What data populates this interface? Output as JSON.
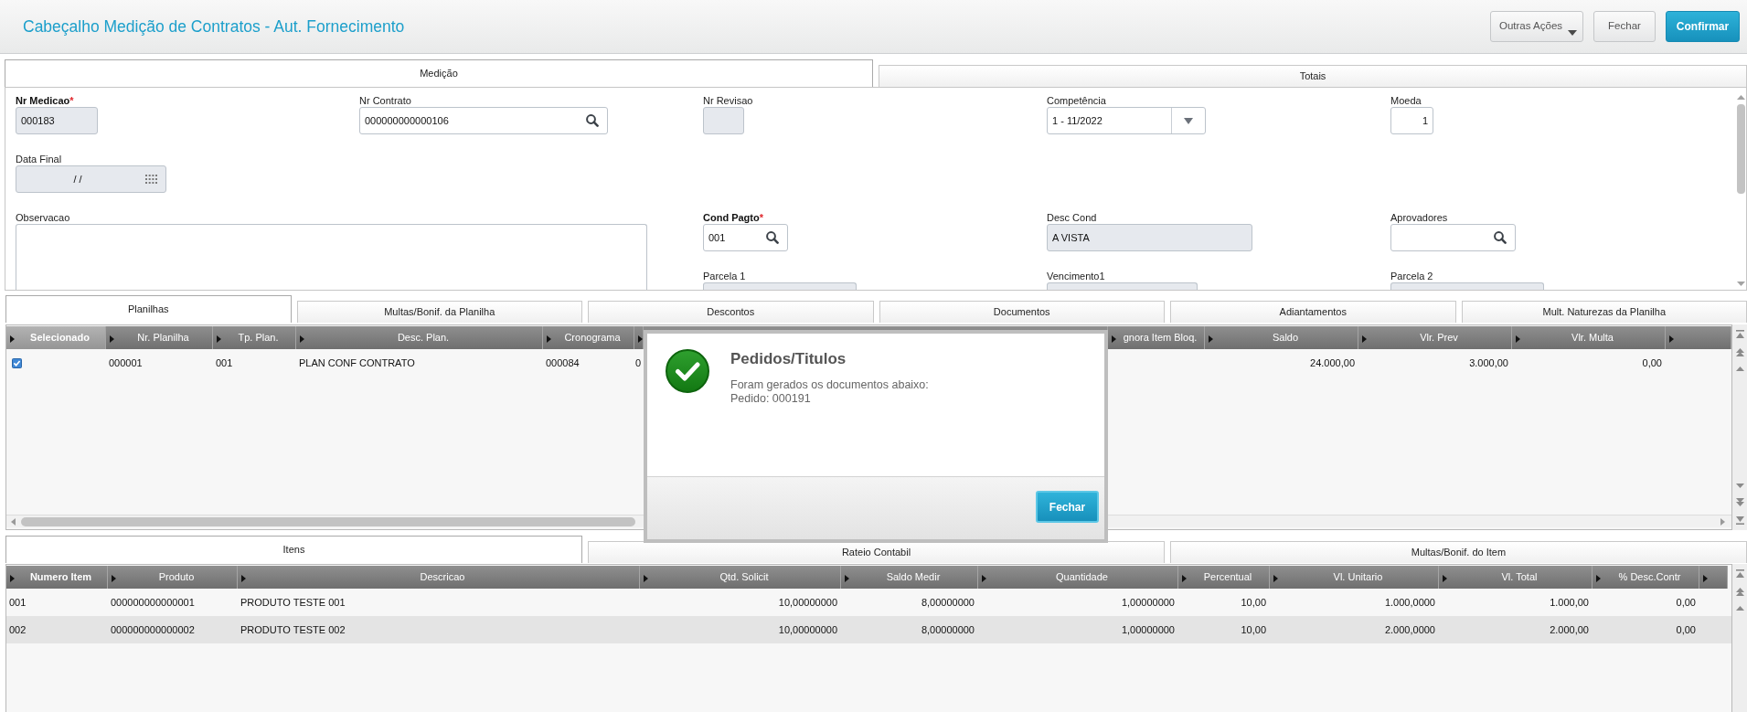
{
  "header": {
    "title": "Cabeçalho Medição de Contratos - Aut. Fornecimento",
    "buttons": [
      {
        "label": "Outras Ações",
        "kind": "menu"
      },
      {
        "label": "Fechar",
        "kind": "close"
      },
      {
        "label": "Confirmar",
        "kind": "confirm"
      }
    ]
  },
  "form_tabs": [
    {
      "label": "Medição",
      "selected": true
    },
    {
      "label": "Totais",
      "selected": false
    }
  ],
  "form": {
    "fields": [
      {
        "label": "Nr Medicao",
        "required": true,
        "required_mark": "*",
        "kind": "text",
        "readonly": true,
        "value": "000183"
      },
      {
        "label": "Nr Contrato",
        "required": false,
        "kind": "lookup",
        "readonly": false,
        "value": "000000000000106"
      },
      {
        "label": "Nr Revisao",
        "required": false,
        "kind": "text",
        "readonly": true
      },
      {
        "label": "Competência",
        "required": false,
        "kind": "select",
        "readonly": false,
        "value": "1 - 11/2022"
      },
      {
        "label": "Moeda",
        "required": false,
        "kind": "number",
        "readonly": false,
        "value": "1"
      },
      {
        "label": "Data Final",
        "required": false,
        "kind": "date",
        "readonly": true,
        "value": "/ /"
      },
      {
        "label": "Observacao",
        "required": false,
        "kind": "textarea",
        "readonly": false
      },
      {
        "label": "Cond Pagto",
        "required": true,
        "required_mark": "*",
        "kind": "lookup",
        "readonly": false,
        "value": "001"
      },
      {
        "label": "Desc Cond",
        "required": false,
        "kind": "text",
        "readonly": true,
        "value": "A VISTA"
      },
      {
        "label": "Aprovadores",
        "required": false,
        "kind": "lookup",
        "readonly": false
      },
      {
        "label": "Parcela 1",
        "required": false,
        "kind": "text",
        "readonly": true
      },
      {
        "label": "Vencimento1",
        "required": false,
        "kind": "text",
        "readonly": true
      },
      {
        "label": "Parcela 2",
        "required": false,
        "kind": "text",
        "readonly": true
      }
    ]
  },
  "planilha_tabs": [
    {
      "label": "Planilhas",
      "selected": true
    },
    {
      "label": "Multas/Bonif. da Planilha",
      "selected": false
    },
    {
      "label": "Descontos",
      "selected": false
    },
    {
      "label": "Documentos",
      "selected": false
    },
    {
      "label": "Adiantamentos",
      "selected": false
    },
    {
      "label": "Mult. Naturezas da Planilha",
      "selected": false
    }
  ],
  "planilhas_table": {
    "columns": [
      {
        "label": "Selecionado",
        "selected": true,
        "sorted": true
      },
      {
        "label": "Nr. Planilha",
        "selected": false,
        "sorted": false
      },
      {
        "label": "Tp. Plan.",
        "selected": false,
        "sorted": false
      },
      {
        "label": "Desc. Plan.",
        "selected": false,
        "sorted": false
      },
      {
        "label": "Cronograma",
        "selected": false,
        "sorted": false
      },
      {
        "selected": false
      },
      {
        "label": "gnora Item Bloq.",
        "selected": false,
        "sorted": false
      },
      {
        "label": "Saldo",
        "selected": false,
        "sorted": false
      },
      {
        "label": "Vlr. Prev",
        "selected": false,
        "sorted": false
      },
      {
        "label": "Vlr. Multa",
        "selected": false,
        "sorted": false
      },
      {
        "selected": false
      }
    ],
    "rows": [
      {
        "checked": true,
        "cells": [
          null,
          "000001",
          "001",
          "PLAN CONF CONTRATO",
          "000084",
          "0",
          null,
          "24.000,00",
          "3.000,00",
          "0,00",
          null
        ]
      }
    ]
  },
  "dialog": {
    "title": "Pedidos/Titulos",
    "message": [
      "Foram gerados os documentos abaixo:",
      "Pedido: 000191"
    ],
    "button": "Fechar"
  },
  "item_tabs": [
    {
      "label": "Itens",
      "selected": true
    },
    {
      "label": "Rateio Contabil",
      "selected": false
    },
    {
      "label": "Multas/Bonif. do Item",
      "selected": false
    }
  ],
  "itens_table": {
    "columns": [
      {
        "label": "Numero Item",
        "selected": false,
        "sorted": true
      },
      {
        "label": "Produto",
        "selected": false,
        "sorted": false
      },
      {
        "label": "Descricao",
        "selected": false,
        "sorted": false
      },
      {
        "label": "Qtd. Solicit",
        "selected": false,
        "sorted": false
      },
      {
        "label": "Saldo Medir",
        "selected": false,
        "sorted": false
      },
      {
        "label": "Quantidade",
        "selected": false,
        "sorted": false
      },
      {
        "label": "Percentual",
        "selected": false,
        "sorted": false
      },
      {
        "label": "Vl. Unitario",
        "selected": false,
        "sorted": false
      },
      {
        "label": "Vl. Total",
        "selected": false,
        "sorted": false
      },
      {
        "label": "% Desc.Contr",
        "selected": false,
        "sorted": false
      },
      {
        "selected": false
      }
    ],
    "rows": [
      {
        "cells": [
          "001",
          "000000000000001",
          "PRODUTO TESTE 001",
          "10,00000000",
          "8,00000000",
          "1,00000000",
          "10,00",
          "1.000,0000",
          "1.000,00",
          "0,00",
          null
        ]
      },
      {
        "cells": [
          "002",
          "000000000000002",
          "PRODUTO TESTE 002",
          "10,00000000",
          "8,00000000",
          "1,00000000",
          "10,00",
          "2.000,0000",
          "2.000,00",
          "0,00",
          null
        ]
      }
    ]
  }
}
